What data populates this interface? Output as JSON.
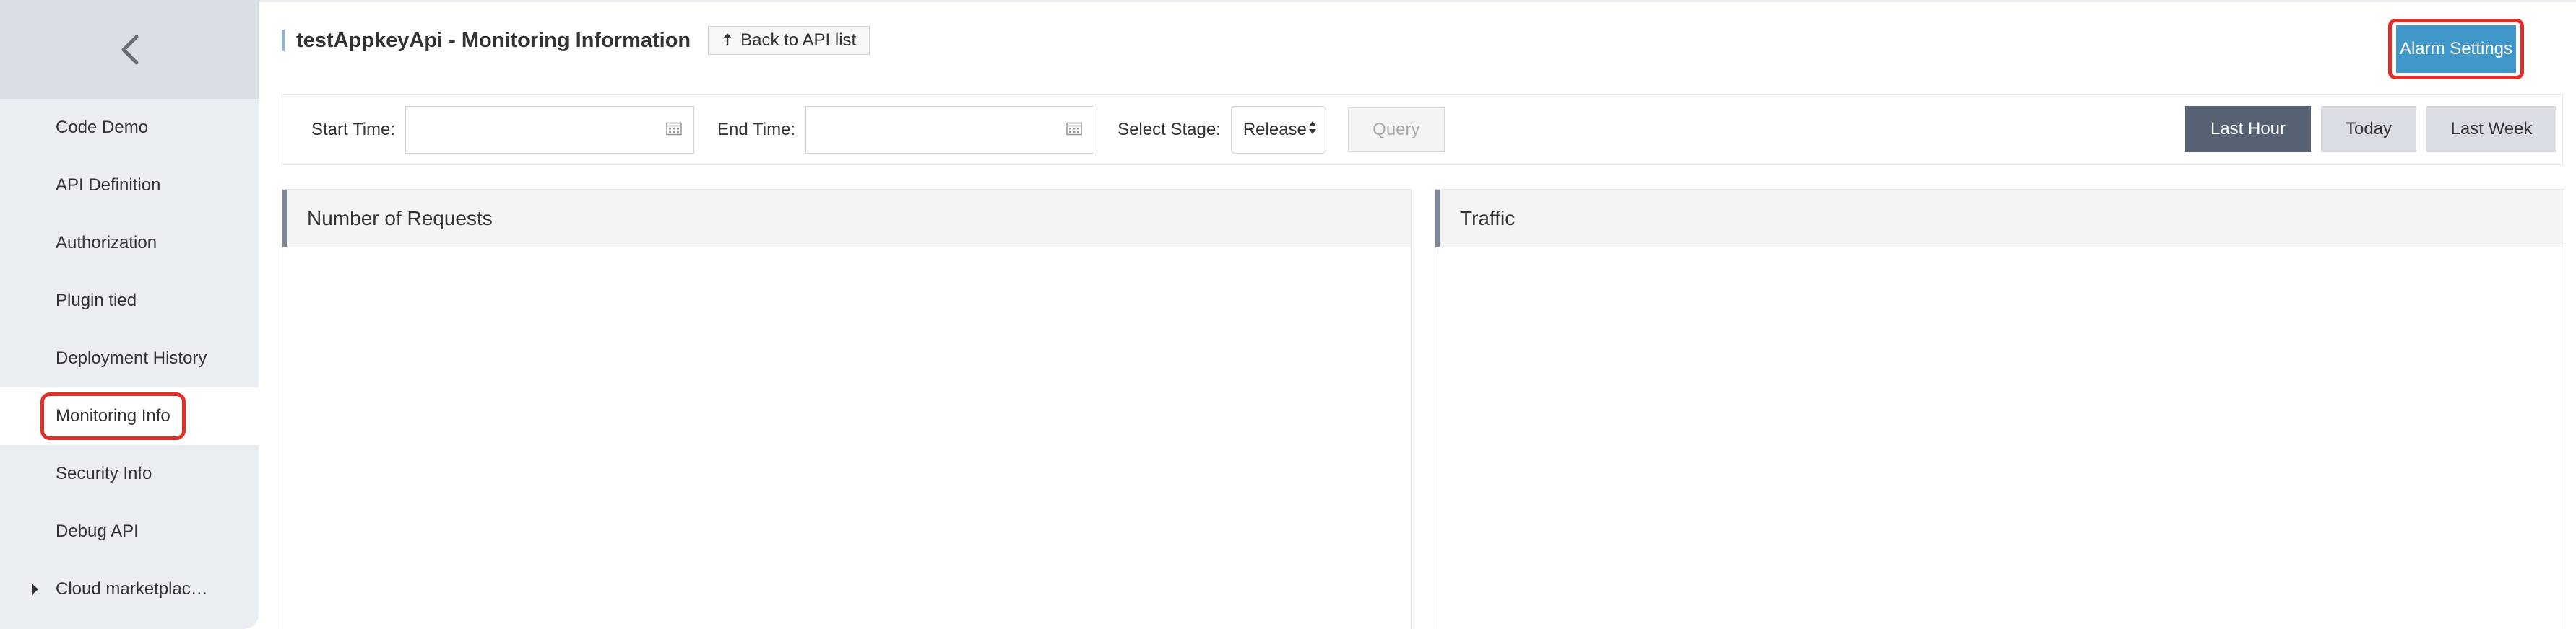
{
  "sidebar": {
    "items": [
      {
        "label": "Code Demo"
      },
      {
        "label": "API Definition"
      },
      {
        "label": "Authorization"
      },
      {
        "label": "Plugin tied"
      },
      {
        "label": "Deployment History"
      },
      {
        "label": "Monitoring Info"
      },
      {
        "label": "Security Info"
      },
      {
        "label": "Debug API"
      },
      {
        "label": "Cloud marketplac…"
      }
    ],
    "active_item": "Monitoring Info"
  },
  "header": {
    "title": "testAppkeyApi - Monitoring Information",
    "back_label": "Back to API list",
    "alarm_label": "Alarm Settings"
  },
  "filter": {
    "start_label": "Start Time:",
    "start_value": "",
    "end_label": "End Time:",
    "end_value": "",
    "stage_label": "Select Stage:",
    "stage_value": "Release",
    "query_label": "Query",
    "ranges": [
      {
        "label": "Last Hour",
        "active": true
      },
      {
        "label": "Today",
        "active": false
      },
      {
        "label": "Last Week",
        "active": false
      }
    ]
  },
  "panels": {
    "requests_title": "Number of Requests",
    "traffic_title": "Traffic"
  },
  "colors": {
    "accent": "#3f97c9",
    "highlight": "#e0302a",
    "active_range": "#566273"
  }
}
